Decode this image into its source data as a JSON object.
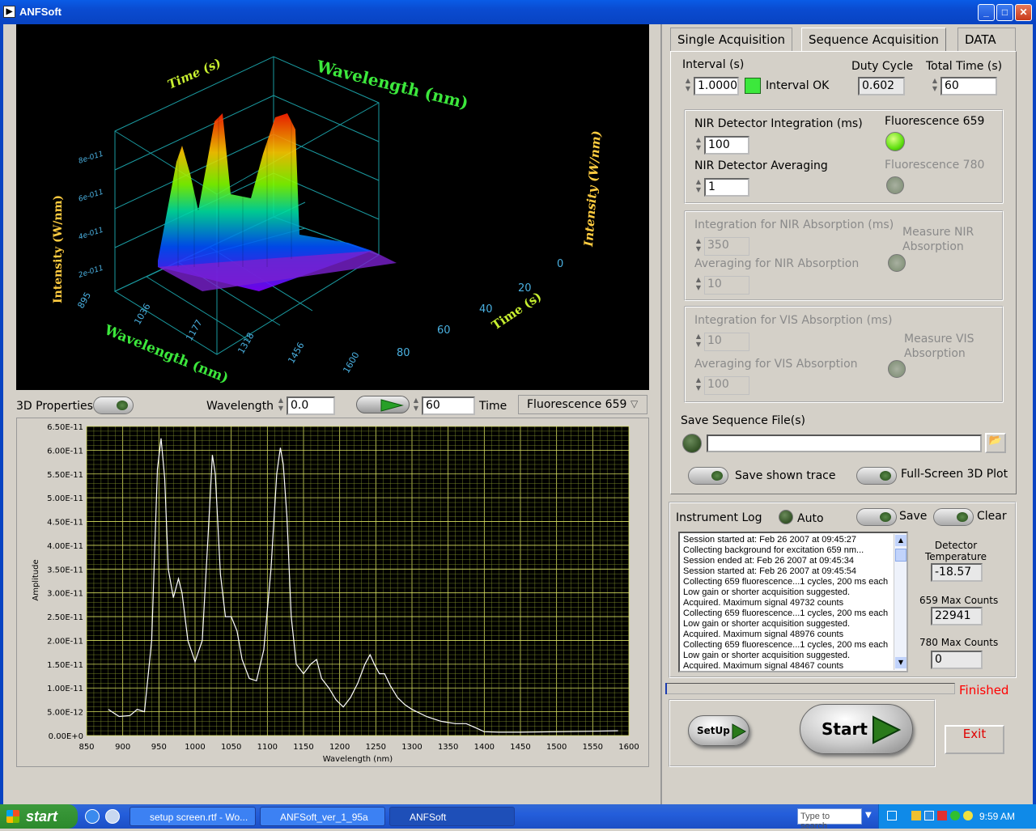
{
  "window": {
    "title": "ANFSoft"
  },
  "surface3d": {
    "title_top": "Wavelength (nm)",
    "time_axis_label": "Time (s)",
    "z_axis_label": "Intensity (W/nm)",
    "z_axis_label_right": "Intensity (W/nm)",
    "z_ticks": [
      "8e-011",
      "6e-011",
      "4e-011",
      "2e-011"
    ],
    "x_axis_label": "Wavelength (nm)",
    "x_ticks": [
      "895",
      "1036",
      "1177",
      "1318",
      "1456",
      "1600"
    ],
    "time_axis_label_bottom": "Time (s)",
    "time_ticks": [
      "0",
      "20",
      "40",
      "60",
      "80"
    ]
  },
  "controls3d": {
    "properties_label": "3D Properties",
    "wavelength_label": "Wavelength",
    "wavelength_value": "0.0",
    "time_value": "60",
    "time_label": "Time",
    "channel_select": "Fluorescence 659"
  },
  "chart_data": {
    "type": "line",
    "xlabel": "Wavelength (nm)",
    "ylabel": "Amplitude",
    "xlim": [
      850,
      1600
    ],
    "ylim": [
      0,
      6.5e-11
    ],
    "x_ticks": [
      "850",
      "900",
      "950",
      "1000",
      "1050",
      "1100",
      "1150",
      "1200",
      "1250",
      "1300",
      "1350",
      "1400",
      "1450",
      "1500",
      "1550",
      "1600"
    ],
    "y_ticks": [
      "6.50E-11",
      "6.00E-11",
      "5.50E-11",
      "5.00E-11",
      "4.50E-11",
      "4.00E-11",
      "3.50E-11",
      "3.00E-11",
      "2.50E-11",
      "2.00E-11",
      "1.50E-11",
      "1.00E-11",
      "5.00E-12",
      "0.00E+0"
    ],
    "series": [
      {
        "x": [
          880,
          895,
          910,
          920,
          930,
          940,
          948,
          953,
          958,
          963,
          970,
          977,
          982,
          990,
          1000,
          1010,
          1018,
          1024,
          1028,
          1035,
          1042,
          1050,
          1058,
          1065,
          1075,
          1085,
          1095,
          1105,
          1113,
          1118,
          1122,
          1127,
          1133,
          1140,
          1150,
          1160,
          1168,
          1175,
          1185,
          1195,
          1205,
          1215,
          1225,
          1235,
          1242,
          1248,
          1255,
          1262,
          1270,
          1280,
          1290,
          1300,
          1320,
          1340,
          1360,
          1375,
          1390,
          1400,
          1420,
          1450,
          1500,
          1550,
          1585
        ],
        "y": [
          5.5e-12,
          4e-12,
          4.2e-12,
          5.5e-12,
          5e-12,
          2e-11,
          5.6e-11,
          6.25e-11,
          5.4e-11,
          3.5e-11,
          2.9e-11,
          3.3e-11,
          3e-11,
          2e-11,
          1.55e-11,
          2e-11,
          4.2e-11,
          5.9e-11,
          5.5e-11,
          3.4e-11,
          2.5e-11,
          2.5e-11,
          2.2e-11,
          1.6e-11,
          1.2e-11,
          1.15e-11,
          1.8e-11,
          3.5e-11,
          5.5e-11,
          6.05e-11,
          5.7e-11,
          4.6e-11,
          2.5e-11,
          1.5e-11,
          1.3e-11,
          1.5e-11,
          1.6e-11,
          1.2e-11,
          1e-11,
          7.5e-12,
          6e-12,
          8e-12,
          1.1e-11,
          1.5e-11,
          1.7e-11,
          1.5e-11,
          1.3e-11,
          1.3e-11,
          1.05e-11,
          8e-12,
          6.5e-12,
          5.5e-12,
          4e-12,
          3e-12,
          2.5e-12,
          2.5e-12,
          1.5e-12,
          8e-13,
          7e-13,
          7e-13,
          8e-13,
          9e-13,
          1e-12
        ]
      }
    ]
  },
  "tabs": [
    {
      "label": "Single Acquisition"
    },
    {
      "label": "Sequence Acquisition"
    },
    {
      "label": "DATA"
    }
  ],
  "sequence": {
    "interval_label": "Interval (s)",
    "interval_value": "1.0000",
    "interval_ok_label": "Interval OK",
    "duty_cycle_label": "Duty Cycle",
    "duty_cycle_value": "0.602",
    "total_time_label": "Total Time (s)",
    "total_time_value": "60",
    "nir_integration_label": "NIR Detector Integration (ms)",
    "nir_integration_value": "100",
    "nir_averaging_label": "NIR Detector Averaging",
    "nir_averaging_value": "1",
    "fluor659_label": "Fluorescence 659",
    "fluor780_label": "Fluorescence 780",
    "nir_abs_integration_label": "Integration for NIR Absorption (ms)",
    "nir_abs_integration_value": "350",
    "nir_abs_averaging_label": "Averaging for NIR Absorption",
    "nir_abs_averaging_value": "10",
    "measure_nir_label": "Measure NIR Absorption",
    "vis_abs_integration_label": "Integration for VIS Absorption (ms)",
    "vis_abs_integration_value": "10",
    "vis_abs_averaging_label": "Averaging for VIS Absorption",
    "vis_abs_averaging_value": "100",
    "measure_vis_label": "Measure VIS Absorption",
    "save_files_label": "Save Sequence File(s)",
    "save_path_value": "",
    "save_trace_label": "Save shown trace",
    "fullscreen_label": "Full-Screen 3D Plot"
  },
  "log": {
    "title": "Instrument Log",
    "auto_label": "Auto",
    "save_label": "Save",
    "clear_label": "Clear",
    "lines": [
      "Session started at: Feb 26 2007 at 09:45:27",
      "Collecting background for excitation 659 nm...",
      "Session ended at: Feb 26 2007 at 09:45:34",
      "Session started at: Feb 26 2007 at 09:45:54",
      "Collecting 659 fluorescence...1 cycles, 200 ms each",
      "Low gain or shorter acquisition suggested.",
      "Acquired. Maximum signal 49732 counts",
      "Collecting 659 fluorescence...1 cycles, 200 ms each",
      "Low gain or shorter acquisition suggested.",
      "Acquired. Maximum signal 48976 counts",
      "Collecting 659 fluorescence...1 cycles, 200 ms each",
      "Low gain or shorter acquisition suggested.",
      "Acquired. Maximum signal 48467 counts"
    ],
    "detector_temp_label": "Detector Temperature",
    "detector_temp_value": "-18.57",
    "max659_label": "659 Max Counts",
    "max659_value": "22941",
    "max780_label": "780 Max Counts",
    "max780_value": "0"
  },
  "status": {
    "text": "Finished",
    "color": "#ff0000",
    "progress": 0.0
  },
  "buttons": {
    "setup": "SetUp",
    "start": "Start",
    "exit": "Exit"
  },
  "taskbar": {
    "start": "start",
    "tasks": [
      "setup screen.rtf - Wo...",
      "ANFSoft_ver_1_95a",
      "ANFSoft"
    ],
    "search_placeholder": "Type to search",
    "clock": "9:59 AM"
  }
}
